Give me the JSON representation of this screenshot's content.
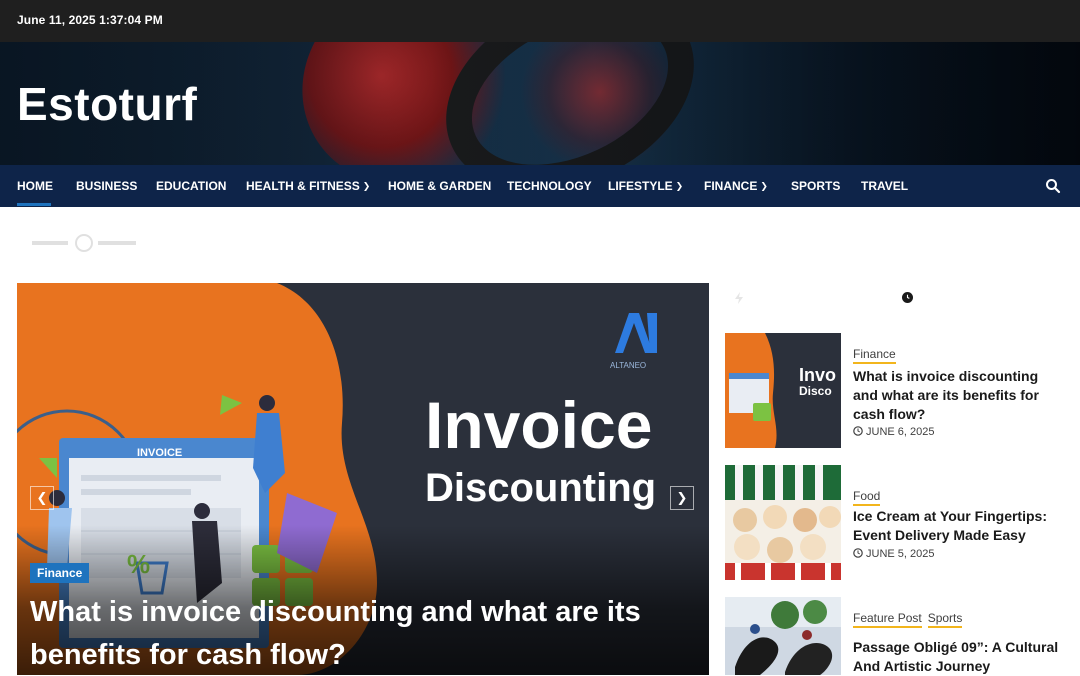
{
  "topbar": {
    "datetime": "June 11, 2025 1:37:04 PM"
  },
  "site": {
    "title": "Estoturf"
  },
  "nav": {
    "items": [
      {
        "label": "HOME",
        "dropdown": false
      },
      {
        "label": "BUSINESS",
        "dropdown": false
      },
      {
        "label": "EDUCATION",
        "dropdown": false
      },
      {
        "label": "HEALTH & FITNESS",
        "dropdown": true
      },
      {
        "label": "HOME & GARDEN",
        "dropdown": false
      },
      {
        "label": "TECHNOLOGY",
        "dropdown": false
      },
      {
        "label": "LIFESTYLE",
        "dropdown": true
      },
      {
        "label": "FINANCE",
        "dropdown": true
      },
      {
        "label": "SPORTS",
        "dropdown": false
      },
      {
        "label": "TRAVEL",
        "dropdown": false
      }
    ],
    "active": "HOME",
    "search_icon": "search-icon"
  },
  "hero": {
    "category": "Finance",
    "title": "What is invoice discounting and what are its benefits for cash flow?",
    "image_text": {
      "line1": "Invoice",
      "line2": "Discounting",
      "brand": "ALTANEO",
      "form_label": "INVOICE"
    },
    "prev_icon": "chevron-left-icon",
    "next_icon": "chevron-right-icon"
  },
  "sidebar": {
    "posts": [
      {
        "categories": [
          "Finance"
        ],
        "title": "What is invoice discounting and what are its benefits for cash flow?",
        "date": "JUNE 6, 2025",
        "thumb_text": [
          "Invo",
          "Disco"
        ]
      },
      {
        "categories": [
          "Food"
        ],
        "title": "Ice Cream at Your Fingertips: Event Delivery Made Easy",
        "date": "JUNE 5, 2025"
      },
      {
        "categories": [
          "Feature Post",
          "Sports"
        ],
        "title": "Passage Obligé 09”: A Cultural And Artistic Journey"
      }
    ]
  },
  "colors": {
    "topbar": "#1f1f1f",
    "nav": "#0e2449",
    "accent": "#1e73be",
    "category_underline": "#f2b51c",
    "hero_orange": "#e8731f"
  }
}
